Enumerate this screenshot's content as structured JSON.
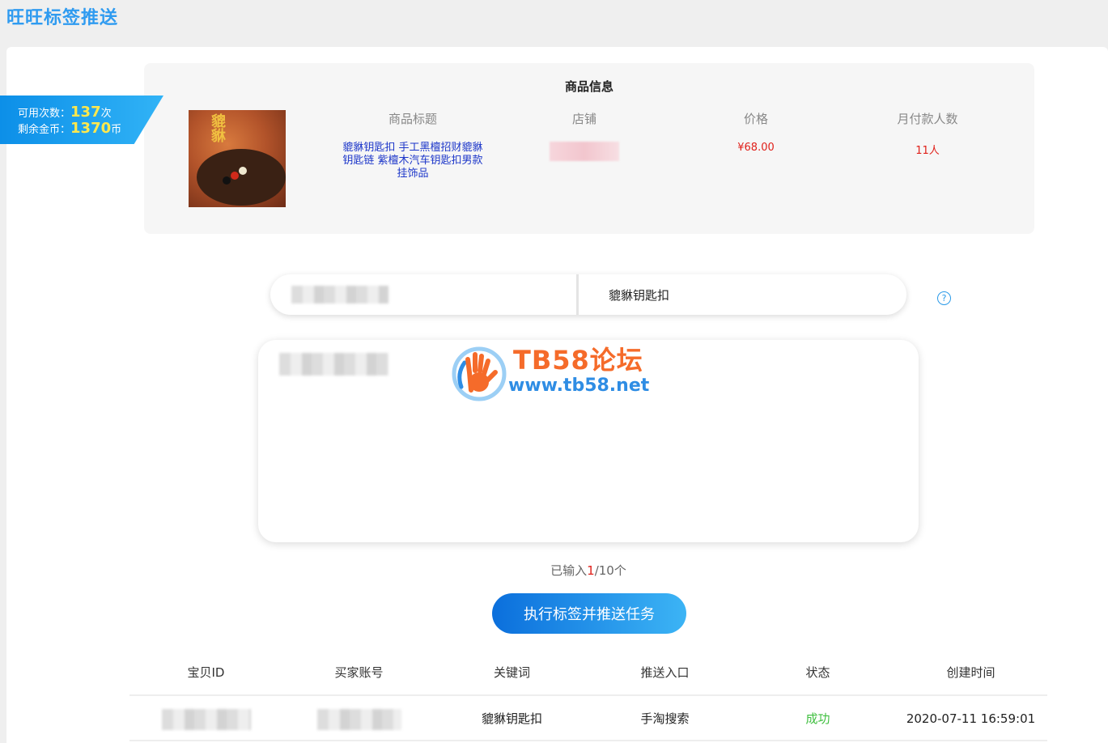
{
  "page": {
    "title": "旺旺标签推送"
  },
  "ribbon": {
    "uses_label": "可用次数：",
    "uses_value": "137",
    "uses_unit": "次",
    "coins_label": "剩余金币：",
    "coins_value": "1370",
    "coins_unit": "币"
  },
  "product": {
    "heading": "商品信息",
    "columns": {
      "title": "商品标题",
      "shop": "店铺",
      "price": "价格",
      "buyers": "月付款人数"
    },
    "title_value": "貔貅钥匙扣 手工黑檀招财貔貅钥匙链 紫檀木汽车钥匙扣男款挂饰品",
    "price_value": "¥68.00",
    "buyers_value": "11人"
  },
  "form": {
    "keyword_value": "貔貅钥匙扣",
    "help_icon": "?"
  },
  "watermark": {
    "title": "TB58论坛",
    "url": "www.tb58.net"
  },
  "counter": {
    "prefix": "已输入",
    "count": "1",
    "suffix": "/10个"
  },
  "submit_label": "执行标签并推送任务",
  "table": {
    "headers": [
      "宝贝ID",
      "买家账号",
      "关键词",
      "推送入口",
      "状态",
      "创建时间"
    ],
    "rows": [
      {
        "keyword": "貔貅钥匙扣",
        "entry": "手淘搜索",
        "status": "成功",
        "created": "2020-07-11 16:59:01"
      }
    ]
  },
  "colors": {
    "accent": "#2f9bf0",
    "price_red": "#e0201a",
    "success_green": "#3fbf3f",
    "link_blue": "#1c36c9"
  }
}
